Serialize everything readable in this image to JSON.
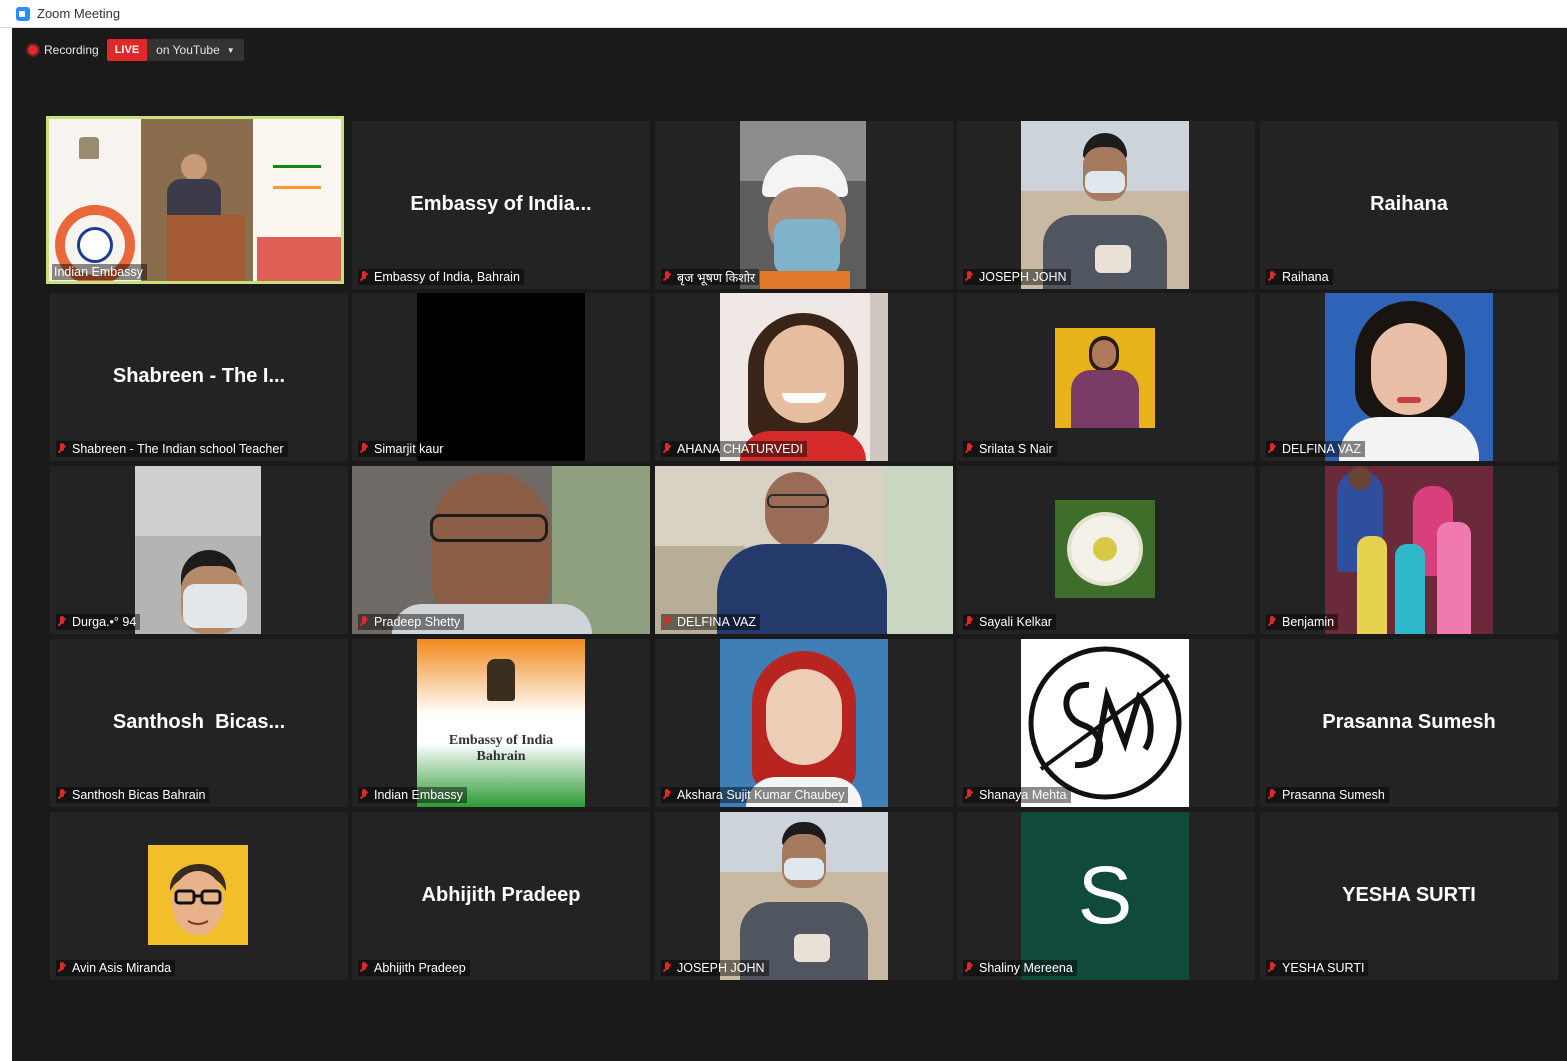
{
  "window": {
    "title": "Zoom Meeting"
  },
  "toolbar": {
    "recording_label": "Recording",
    "live_badge": "LIVE",
    "stream_target": "on YouTube"
  },
  "participants": [
    {
      "display_name": "Indian Embassy",
      "video": "stage"
    },
    {
      "display_name": "Embassy of India, Bahrain",
      "tile_name": "Embassy of India..."
    },
    {
      "display_name": "बृज भूषण किशोर",
      "video": "helmet"
    },
    {
      "display_name": "JOSEPH JOHN",
      "video": "boy"
    },
    {
      "display_name": "Raihana",
      "tile_name": "Raihana"
    },
    {
      "display_name": "Shabreen - The Indian school Teacher",
      "tile_name": "Shabreen - The I..."
    },
    {
      "display_name": "Simarjit kaur",
      "video": "black"
    },
    {
      "display_name": "AHANA CHATURVEDI",
      "video": "girl"
    },
    {
      "display_name": "Srilata S Nair",
      "video": "woman-yellow"
    },
    {
      "display_name": "DELFINA VAZ",
      "video": "woman-blue"
    },
    {
      "display_name": "Durga.•° 94",
      "video": "car-mask"
    },
    {
      "display_name": "Pradeep Shetty",
      "video": "man-glasses"
    },
    {
      "display_name": "DELFINA VAZ",
      "video": "woman-home"
    },
    {
      "display_name": "Sayali Kelkar",
      "video": "flower"
    },
    {
      "display_name": "Benjamin",
      "video": "family"
    },
    {
      "display_name": "Santhosh  Bicas Bahrain",
      "tile_name": "Santhosh  Bicas..."
    },
    {
      "display_name": "Indian Embassy",
      "video": "flag-logo",
      "logo_line1": "Embassy of India",
      "logo_line2": "Bahrain"
    },
    {
      "display_name": "Akshara Sujit Kumar Chaubey",
      "video": "girl-portrait"
    },
    {
      "display_name": "Shanaya Mehta",
      "video": "sm-logo"
    },
    {
      "display_name": "Prasanna Sumesh",
      "tile_name": "Prasanna Sumesh"
    },
    {
      "display_name": "Avin Asis Miranda",
      "video": "cartoon"
    },
    {
      "display_name": "Abhijith Pradeep",
      "tile_name": "Abhijith Pradeep"
    },
    {
      "display_name": "JOSEPH JOHN",
      "video": "boy"
    },
    {
      "display_name": "Shaliny Mereena",
      "video": "letter-avatar",
      "avatar_letter": "S"
    },
    {
      "display_name": "YESHA SURTI",
      "tile_name": "YESHA SURTI"
    }
  ],
  "colors": {
    "active_speaker_border": "#c8e07a",
    "muted_mic": "#e02828",
    "live_badge": "#e02828",
    "tile_bg": "#232323"
  }
}
